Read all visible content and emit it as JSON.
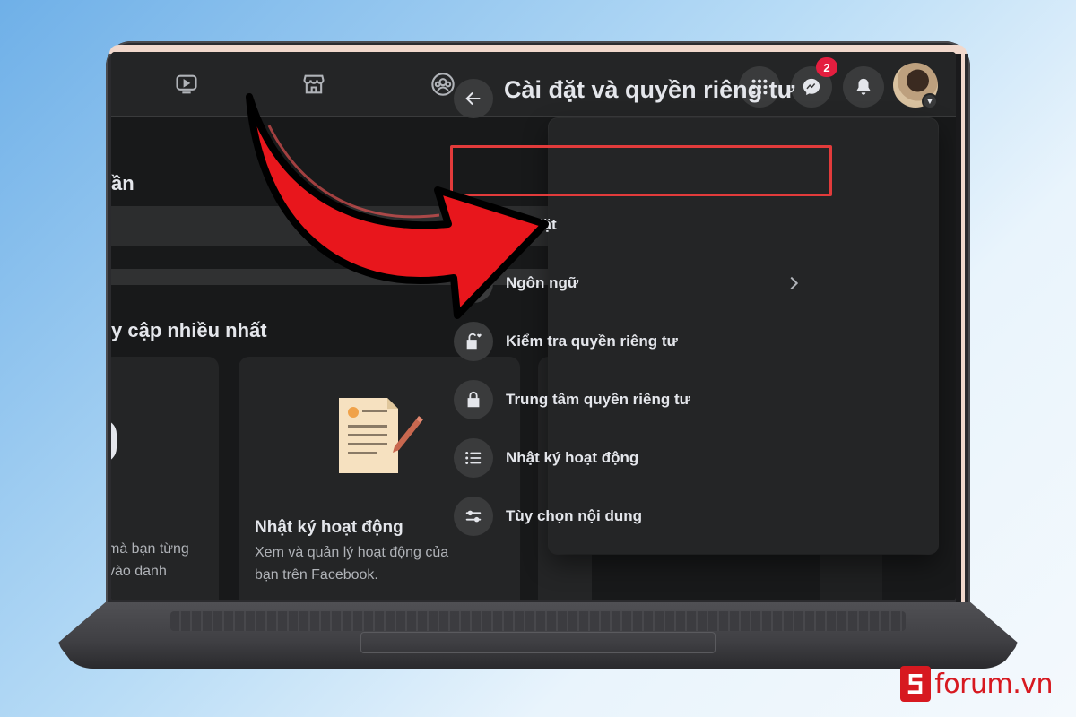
{
  "topbar": {
    "nav_icons": [
      "watch-icon",
      "marketplace-icon",
      "groups-icon"
    ],
    "actions": [
      "menu-grid-icon",
      "messenger-icon",
      "notifications-icon"
    ],
    "messenger_badge": "2"
  },
  "background_page": {
    "heading_fragment": "ần",
    "section_fragment": "y cập nhiều nhất",
    "left_card_desc_lines": [
      "mà bạn từng",
      "vào danh"
    ],
    "card": {
      "title": "Nhật ký hoạt động",
      "desc_lines": [
        "Xem và quản lý hoạt động của",
        "bạn trên Facebook."
      ]
    }
  },
  "menu": {
    "title": "Cài đặt và quyền riêng tư",
    "items": [
      {
        "label": "Cài đặt",
        "icon": "gear-icon",
        "highlighted": true
      },
      {
        "label": "Ngôn ngữ",
        "icon": "globe-icon",
        "has_chevron": true
      },
      {
        "label": "Kiểm tra quyền riêng tư",
        "icon": "lock-heart-icon"
      },
      {
        "label": "Trung tâm quyền riêng tư",
        "icon": "lock-icon"
      },
      {
        "label": "Nhật ký hoạt động",
        "icon": "list-icon"
      },
      {
        "label": "Tùy chọn nội dung",
        "icon": "sliders-icon"
      }
    ]
  },
  "colors": {
    "screen_bg": "#18191a",
    "surface": "#242526",
    "button": "#3a3b3c",
    "text_primary": "#e4e6eb",
    "text_secondary": "#b0b3b8",
    "highlight": "#e23b3b",
    "arrow": "#e8161c",
    "badge": "#e41e3f"
  },
  "watermark": {
    "logo_letter": "S",
    "text": "forum.vn"
  }
}
